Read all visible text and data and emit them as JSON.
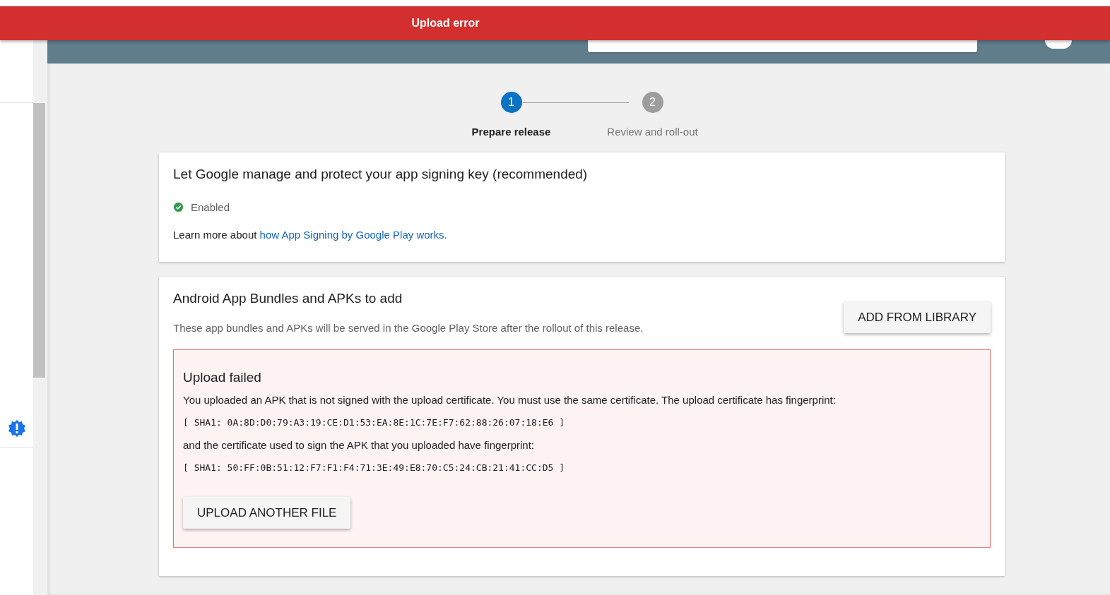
{
  "banner": {
    "title": "Upload error"
  },
  "stepper": [
    {
      "number": "1",
      "label": "Prepare release",
      "selected": true
    },
    {
      "number": "2",
      "label": "Review and roll-out",
      "selected": false
    }
  ],
  "signing_card": {
    "title": "Let Google manage and protect your app signing key (recommended)",
    "status": "Enabled",
    "enabled": true,
    "learn_more": "Learn more about ",
    "link": "how App Signing by Google Play works."
  },
  "bundles_card": {
    "title": "Android App Bundles and APKs to add",
    "description": "These app bundles and APKs will be served in the Google Play Store after the rollout of this release.",
    "button": "ADD FROM LIBRARY",
    "error": {
      "title": "Upload failed",
      "message": "You uploaded an APK that is not signed with the upload certificate. You must use the same certificate. The upload certificate has fingerprint:",
      "expected_fingerprint": "[ SHA1: 0A:8D:D0:79:A3:19:CE:D1:53:EA:8E:1C:7E:F7:62:88:26:07:18:E6 ]",
      "note": "and the certificate used to sign the APK that you uploaded have fingerprint:",
      "actual_fingerprint": "[ SHA1: 50:FF:0B:51:12:F7:F1:F4:71:3E:49:E8:70:C5:24:CB:21:41:CC:D5 ]",
      "button": "UPLOAD ANOTHER FILE"
    }
  }
}
